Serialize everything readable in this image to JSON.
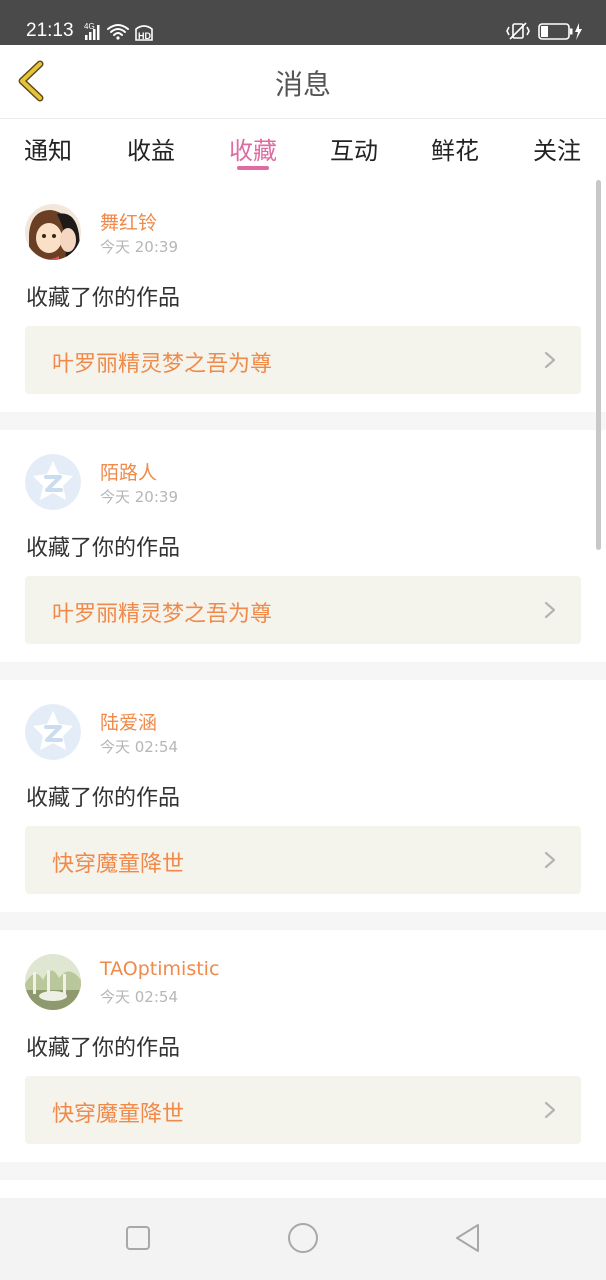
{
  "status_bar": {
    "time": "21:13",
    "icons_left": [
      "signal-4g-icon",
      "wifi-icon",
      "hd-icon"
    ],
    "icons_right": [
      "vibrate-icon",
      "battery-icon",
      "charging-icon"
    ]
  },
  "header": {
    "title": "消息",
    "back_icon": "chevron-left-icon",
    "accent_color": "#e5c43a"
  },
  "tabs": {
    "items": [
      {
        "label": "通知"
      },
      {
        "label": "收益"
      },
      {
        "label": "收藏"
      },
      {
        "label": "互动"
      },
      {
        "label": "鲜花"
      },
      {
        "label": "关注"
      }
    ],
    "active_label": "收藏",
    "active_color": "#e06aa2"
  },
  "notifications": [
    {
      "username": "舞红铃",
      "time": "今天 20:39",
      "message": "收藏了你的作品",
      "work_title": "叶罗丽精灵梦之吾为尊",
      "avatar": "anime-avatar"
    },
    {
      "username": "陌路人",
      "time": "今天 20:39",
      "message": "收藏了你的作品",
      "work_title": "叶罗丽精灵梦之吾为尊",
      "avatar": "default-qq-avatar"
    },
    {
      "username": "陆爱涵",
      "time": "今天 02:54",
      "message": "收藏了你的作品",
      "work_title": "快穿魔童降世",
      "avatar": "default-qq-avatar"
    },
    {
      "username": "TAOptimistic",
      "time": "今天 02:54",
      "message": "收藏了你的作品",
      "work_title": "快穿魔童降世",
      "avatar": "photo-avatar"
    }
  ],
  "colors": {
    "username": "#f08a4b",
    "work_card_bg": "#f5f4ec",
    "separator": "#f6f6f6"
  },
  "nav_bar": {
    "icons": [
      "recent-apps-icon",
      "home-icon",
      "back-icon"
    ]
  }
}
